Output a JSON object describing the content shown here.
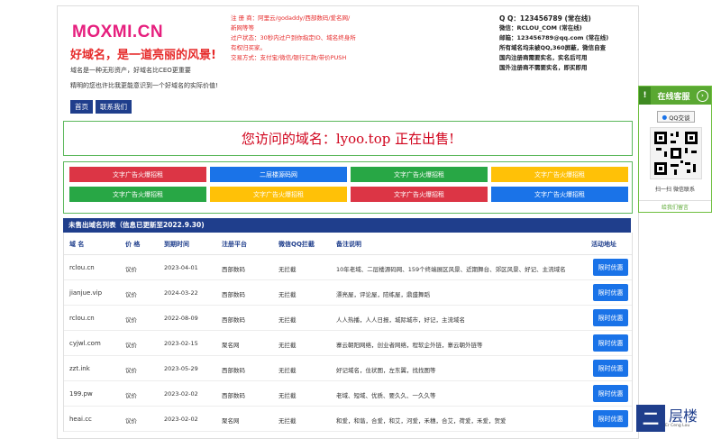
{
  "header": {
    "logo": "MOXMI.CN",
    "slogan": "好域名，是一道亮丽的风景!",
    "desc1": "域名是一种无形资产，好域名比CEO更重要",
    "desc2": "精明的您也许比我更能意识到一个好域名的实际价值!",
    "nav": [
      "首页",
      "联系我们"
    ]
  },
  "info": {
    "line1": "注 册 商：阿里云/godaddy/西部数码/爱名网/",
    "line2": "新网等等",
    "line3": "过户状态：30秒内过户到你指定ID、域名终身所",
    "line4": "有权归买家。",
    "line5": "交易方式：支付宝/微信/银行汇款/带价PUSH"
  },
  "contact": {
    "qq": "Q Q：123456789 (常在线)",
    "wechat": "微信：RCLOU_COM (常在线)",
    "email": "邮箱：123456789@qq.com (常在线)",
    "note1": "所有域名均未被QQ,360屏蔽，微信自查",
    "note2": "国内注册商需要实名，实名后可用",
    "note3": "国外注册商不需要实名，即买即用"
  },
  "banner": "您访问的域名：lyoo.top 正在出售!",
  "ads": [
    {
      "label": "文字广告火爆招租",
      "color": "#dc3545"
    },
    {
      "label": "二层楼源码网",
      "color": "#1a73e8"
    },
    {
      "label": "文字广告火爆招租",
      "color": "#28a745"
    },
    {
      "label": "文字广告火爆招租",
      "color": "#ffc107"
    },
    {
      "label": "文字广告火爆招租",
      "color": "#28a745"
    },
    {
      "label": "文字广告火爆招租",
      "color": "#ffc107"
    },
    {
      "label": "文字广告火爆招租",
      "color": "#dc3545"
    },
    {
      "label": "文字广告火爆招租",
      "color": "#1a73e8"
    }
  ],
  "list": {
    "title": "未售出域名列表（信息已更新至2022.9.30)",
    "columns": [
      "域 名",
      "价 格",
      "到期时间",
      "注册平台",
      "微信QQ拦截",
      "备注说明",
      "活动地址"
    ],
    "rows": [
      {
        "domain": "rclou.cn",
        "price": "议价",
        "expire": "2023-04-01",
        "registrar": "西部数码",
        "block": "无拦截",
        "note": "10年老域、二层楼源码网、159个终端展区风景、近期舞台、郊区风景、好记、主流域名",
        "action": "限时优惠"
      },
      {
        "domain": "jianjue.vip",
        "price": "议价",
        "expire": "2024-03-22",
        "registrar": "西部数码",
        "block": "无拦截",
        "note": "漂亮屋，评论屋，陪练屋，鼎盛舞蹈",
        "action": "限时优惠"
      },
      {
        "domain": "rclou.cn",
        "price": "议价",
        "expire": "2022-08-09",
        "registrar": "西部数码",
        "block": "无拦截",
        "note": "人人热播，人人日报，城际城市，好记，主流域名",
        "action": "限时优惠"
      },
      {
        "domain": "cyjwl.com",
        "price": "议价",
        "expire": "2023-02-15",
        "registrar": "聚名网",
        "block": "无拦截",
        "note": "寨云朝阳网络，创业者网络，程软企外链，寨云朝外链等",
        "action": "限时优惠"
      },
      {
        "domain": "zzt.ink",
        "price": "议价",
        "expire": "2023-05-29",
        "registrar": "西部数码",
        "block": "无拦截",
        "note": "好记域名，住状图，左东翼，找找图等",
        "action": "限时优惠"
      },
      {
        "domain": "199.pw",
        "price": "议价",
        "expire": "2023-02-02",
        "registrar": "西部数码",
        "block": "无拦截",
        "note": "老域、短域、优质、要久久、一久久等",
        "action": "限时优惠"
      },
      {
        "domain": "heai.cc",
        "price": "议价",
        "expire": "2023-02-02",
        "registrar": "聚名网",
        "block": "无拦截",
        "note": "和爱，和谐，合爱，和艾，河爱，禾穗，合艾，荷爱，禾爱，贺爱",
        "action": "限时优惠"
      }
    ]
  },
  "sidebar": {
    "title": "在线客服",
    "qq_button": "QQ交谈",
    "scan_text": "扫一扫 微信联系",
    "more_link": "给我们留言"
  },
  "brand": {
    "mark": "二",
    "name": "层楼",
    "sub": "Er Ceng Lou"
  }
}
